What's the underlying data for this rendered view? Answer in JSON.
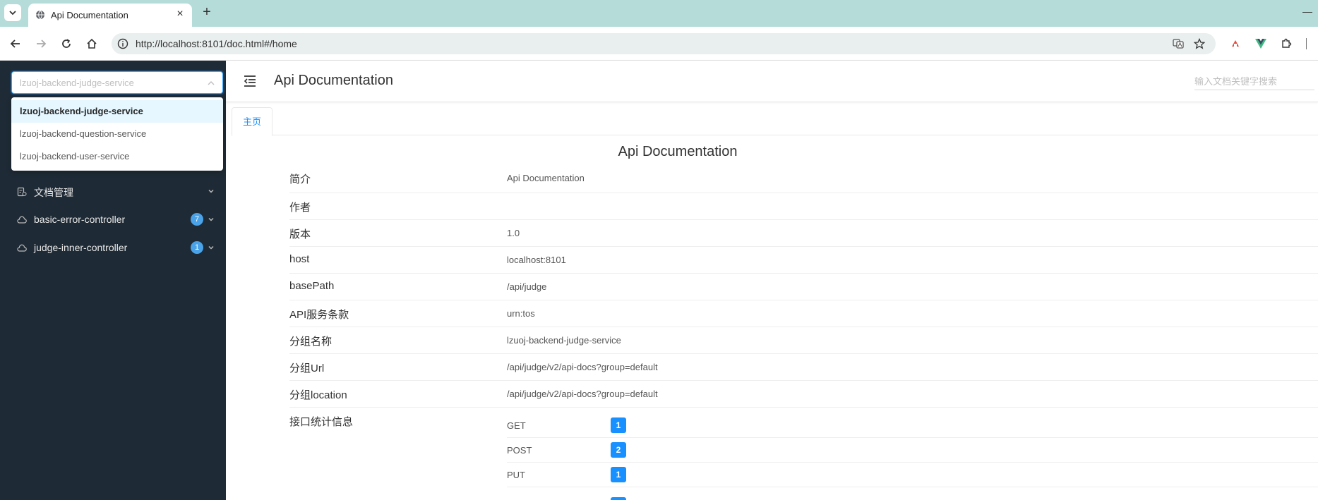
{
  "browser": {
    "tab_title": "Api Documentation",
    "url": "http://localhost:8101/doc.html#/home"
  },
  "sidebar": {
    "service_select": {
      "value": "lzuoj-backend-judge-service",
      "options": [
        "lzuoj-backend-judge-service",
        "lzuoj-backend-question-service",
        "lzuoj-backend-user-service"
      ]
    },
    "menu": [
      {
        "label": "文档管理",
        "badge": ""
      },
      {
        "label": "basic-error-controller",
        "badge": "7"
      },
      {
        "label": "judge-inner-controller",
        "badge": "1"
      }
    ]
  },
  "header": {
    "title": "Api Documentation",
    "search_placeholder": "输入文档关键字搜索"
  },
  "tabs": [
    {
      "label": "主页"
    }
  ],
  "doc": {
    "title": "Api Documentation",
    "rows": [
      {
        "label": "简介",
        "value": "Api Documentation"
      },
      {
        "label": "作者",
        "value": ""
      },
      {
        "label": "版本",
        "value": "1.0"
      },
      {
        "label": "host",
        "value": "localhost:8101"
      },
      {
        "label": "basePath",
        "value": "/api/judge"
      },
      {
        "label": "API服务条款",
        "value": "urn:tos"
      },
      {
        "label": "分组名称",
        "value": "lzuoj-backend-judge-service"
      },
      {
        "label": "分组Url",
        "value": "/api/judge/v2/api-docs?group=default"
      },
      {
        "label": "分组location",
        "value": "/api/judge/v2/api-docs?group=default"
      }
    ],
    "stats_label": "接口统计信息",
    "stats": [
      {
        "method": "GET",
        "count": "1"
      },
      {
        "method": "POST",
        "count": "2"
      },
      {
        "method": "PUT",
        "count": "1"
      }
    ]
  },
  "colors": {
    "sidebar_bg": "#1e2a35",
    "accent": "#1890ff",
    "tabstrip_bg": "#b5dcd9"
  }
}
